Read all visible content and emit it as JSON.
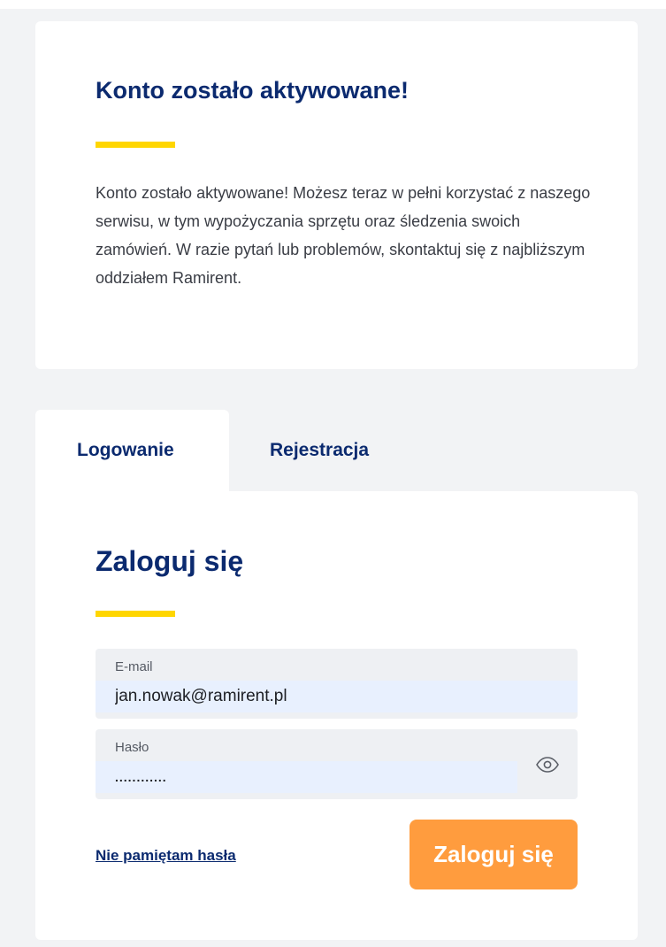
{
  "colors": {
    "primary_text": "#0b2a6f",
    "accent_yellow": "#ffd600",
    "button_orange": "#ff9c3e",
    "page_background": "#f2f3f5",
    "autofill_blue": "#e8f0fe"
  },
  "activation": {
    "title": "Konto zostało aktywowane!",
    "message": "Konto zostało aktywowane! Możesz teraz w pełni korzystać z naszego serwisu, w tym wypożyczania sprzętu oraz śledzenia swoich zamówień. W razie pytań lub problemów, skontaktuj się z najbliższym oddziałem Ramirent."
  },
  "tabs": [
    {
      "label": "Logowanie",
      "active": true
    },
    {
      "label": "Rejestracja",
      "active": false
    }
  ],
  "login": {
    "title": "Zaloguj się",
    "email": {
      "label": "E-mail",
      "value": "jan.nowak@ramirent.pl"
    },
    "password": {
      "label": "Hasło",
      "value": "............",
      "toggle_icon": "eye-icon"
    },
    "forgot_link": "Nie pamiętam hasła",
    "submit_label": "Zaloguj się"
  }
}
